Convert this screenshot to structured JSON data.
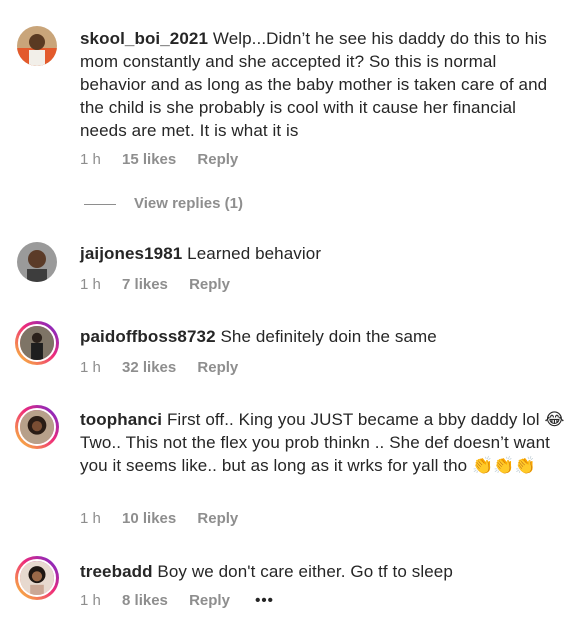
{
  "comments": [
    {
      "username": "skool_boi_2021",
      "text": "Welp...Didn’t he see his daddy do this to his mom constantly and she accepted it? So this is normal behavior and as long as the baby mother is taken care of and the child is she probably is cool with it cause her financial needs are met. It is what it is",
      "time": "1 h",
      "likes": "15 likes",
      "reply": "Reply",
      "avatar_icon": "user-avatar-icon",
      "has_story_ring": false
    },
    {
      "username": "jaijones1981",
      "text": "Learned behavior",
      "time": "1 h",
      "likes": "7 likes",
      "reply": "Reply",
      "avatar_icon": "user-avatar-icon",
      "has_story_ring": false
    },
    {
      "username": "paidoffboss8732",
      "text": "She definitely doin the same",
      "time": "1 h",
      "likes": "32 likes",
      "reply": "Reply",
      "avatar_icon": "user-avatar-icon",
      "has_story_ring": true
    },
    {
      "username": "toophanci",
      "text": "First off.. King you JUST became a bby daddy lol 😂 Two.. This not the flex you prob thinkn .. She def doesn’t want you it seems like.. but as long as it wrks for yall tho 👏👏👏",
      "time": "1 h",
      "likes": "10 likes",
      "reply": "Reply",
      "avatar_icon": "user-avatar-icon",
      "has_story_ring": true
    },
    {
      "username": "treebadd",
      "text": "Boy we don't care either. Go tf to sleep",
      "time": "1 h",
      "likes": "8 likes",
      "reply": "Reply",
      "more": "•••",
      "avatar_icon": "user-avatar-icon",
      "has_story_ring": true
    }
  ],
  "view_replies": "View replies (1)",
  "colors": {
    "text": "#262626",
    "secondary": "#8e8e8e",
    "story_ring_start": "#f9ce34",
    "story_ring_mid": "#ee2a7b",
    "story_ring_end": "#6228d7"
  }
}
